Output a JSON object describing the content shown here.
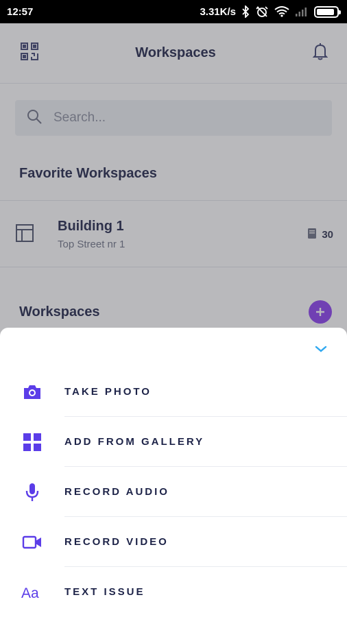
{
  "status_bar": {
    "time": "12:57",
    "net_speed": "3.31K/s",
    "battery_level": 0.9
  },
  "header": {
    "title": "Workspaces",
    "left_icon": "qr-code-icon",
    "right_icon": "bell-icon"
  },
  "search": {
    "placeholder": "Search..."
  },
  "favorites": {
    "title": "Favorite Workspaces",
    "items": [
      {
        "name": "Building 1",
        "address": "Top Street nr 1",
        "count": "30",
        "icon": "layout-icon"
      }
    ]
  },
  "workspaces": {
    "title": "Workspaces",
    "add_icon": "plus-icon"
  },
  "sheet": {
    "collapse_icon": "chevron-down-icon",
    "options": [
      {
        "label": "TAKE PHOTO",
        "icon": "camera-icon"
      },
      {
        "label": "ADD FROM GALLERY",
        "icon": "grid-icon"
      },
      {
        "label": "RECORD AUDIO",
        "icon": "microphone-icon"
      },
      {
        "label": "RECORD VIDEO",
        "icon": "video-camera-icon"
      },
      {
        "label": "TEXT ISSUE",
        "icon": "text-icon"
      }
    ]
  },
  "colors": {
    "accent": "#5b3de8",
    "title_text": "#1d2348",
    "collapse": "#2fa8f0",
    "add_button": "#8a3df0"
  }
}
